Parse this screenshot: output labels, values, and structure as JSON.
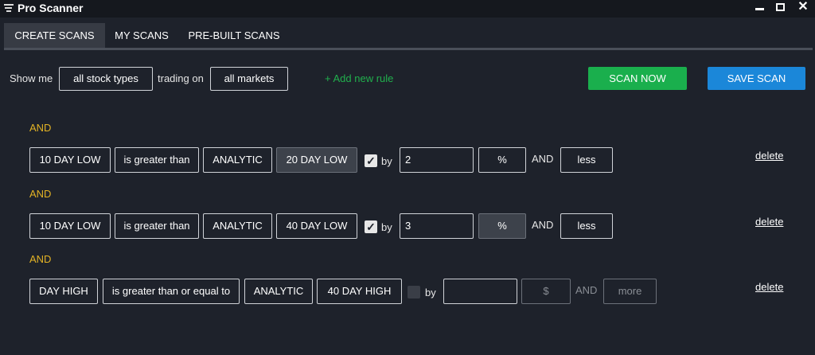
{
  "window": {
    "title": "Pro Scanner",
    "menu_icon": "hamburger-filter-icon",
    "controls": {
      "minimize": "minimize-icon",
      "maximize": "maximize-icon",
      "close": "✕"
    }
  },
  "tabs": [
    {
      "label": "CREATE SCANS",
      "active": true
    },
    {
      "label": "MY SCANS",
      "active": false
    },
    {
      "label": "PRE-BUILT SCANS",
      "active": false
    }
  ],
  "filter": {
    "show_me_label": "Show me",
    "stock_type": "all stock types",
    "trading_on_label": "trading on",
    "market": "all markets",
    "add_rule": "+ Add new rule"
  },
  "actions": {
    "scan_now": "SCAN NOW",
    "save_scan": "SAVE SCAN"
  },
  "colors": {
    "accent_green": "#1aaf4d",
    "accent_blue": "#1b87d9",
    "and_yellow": "#e3b325"
  },
  "rules": [
    {
      "conjunction": "AND",
      "field": "10 DAY LOW",
      "operator": "is greater than",
      "type": "ANALYTIC",
      "compare_to": "20 DAY LOW",
      "by_checked": true,
      "by_label": "by",
      "value": "2",
      "unit": "%",
      "and_label": "AND",
      "direction": "less",
      "delete_label": "delete"
    },
    {
      "conjunction": "AND",
      "field": "10 DAY LOW",
      "operator": "is greater than",
      "type": "ANALYTIC",
      "compare_to": "40 DAY LOW",
      "by_checked": true,
      "by_label": "by",
      "value": "3",
      "unit": "%",
      "and_label": "AND",
      "direction": "less",
      "delete_label": "delete"
    },
    {
      "conjunction": "AND",
      "field": "DAY HIGH",
      "operator": "is greater than or equal to",
      "type": "ANALYTIC",
      "compare_to": "40 DAY HIGH",
      "by_checked": false,
      "by_label": "by",
      "value": "",
      "unit": "$",
      "and_label": "AND",
      "direction": "more",
      "delete_label": "delete"
    }
  ]
}
